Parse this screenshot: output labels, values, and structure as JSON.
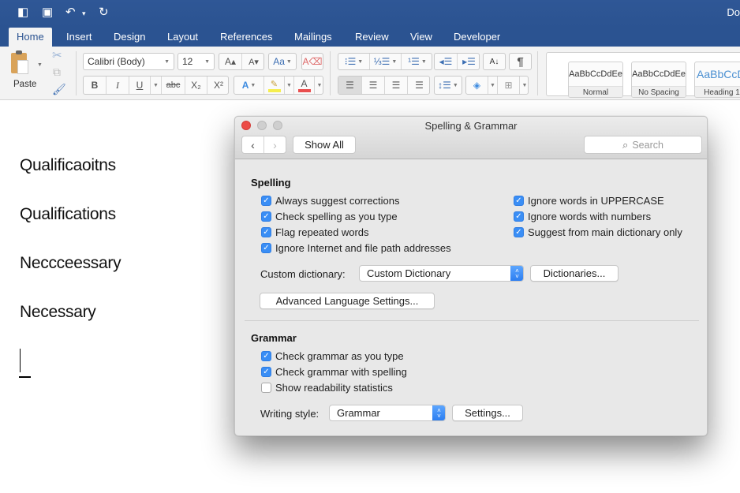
{
  "window": {
    "title_partial": "Do"
  },
  "quick_access": {
    "icons": [
      "sidebar-icon",
      "save-icon",
      "undo-icon",
      "redo-icon"
    ],
    "glyphs": {
      "sidebar": "◧",
      "save": "▣",
      "undo": "↶",
      "undo_caret": "▾",
      "redo": "↻"
    }
  },
  "tabs": [
    {
      "label": "Home",
      "active": true
    },
    {
      "label": "Insert",
      "active": false
    },
    {
      "label": "Design",
      "active": false
    },
    {
      "label": "Layout",
      "active": false
    },
    {
      "label": "References",
      "active": false
    },
    {
      "label": "Mailings",
      "active": false
    },
    {
      "label": "Review",
      "active": false
    },
    {
      "label": "View",
      "active": false
    },
    {
      "label": "Developer",
      "active": false
    }
  ],
  "ribbon": {
    "paste_label": "Paste",
    "font_name": "Calibri (Body)",
    "font_size": "12",
    "format_glyphs": {
      "grow": "A▴",
      "shrink": "A▾",
      "change_case": "Aa",
      "clear": "A⌫",
      "bold": "B",
      "italic": "I",
      "underline": "U",
      "strike": "abc",
      "subscript": "X₂",
      "superscript": "X²",
      "text_effects": "A",
      "highlight": "✎",
      "font_color": "A",
      "bullets": "⁝☰",
      "numbering": "⅓☰",
      "multilevel": "¹☰",
      "decrease_indent": "◂☰",
      "increase_indent": "▸☰",
      "sort": "A↓",
      "pilcrow": "¶",
      "align_left": "☰",
      "align_center": "☰",
      "align_right": "☰",
      "justify": "☰",
      "line_spacing": "↕☰",
      "shading": "◈",
      "borders": "⊞"
    },
    "colors": {
      "highlight": "#f5ee4e",
      "font_color": "#e94e4e",
      "heading_blue": "#4a8fd1"
    },
    "styles": [
      {
        "sample": "AaBbCcDdEe",
        "name": "Normal"
      },
      {
        "sample": "AaBbCcDdEe",
        "name": "No Spacing"
      },
      {
        "sample": "AaBbCcDd",
        "name": "Heading 1"
      }
    ]
  },
  "document": {
    "lines": [
      "Qualificaoitns",
      "Qualifications",
      "Neccceessary",
      "Necessary"
    ]
  },
  "dialog": {
    "title": "Spelling & Grammar",
    "back_glyph": "‹",
    "forward_glyph": "›",
    "show_all_label": "Show All",
    "search_placeholder": "Search",
    "search_glyph": "⌕",
    "spelling": {
      "heading": "Spelling",
      "left_options": [
        {
          "label": "Always suggest corrections",
          "checked": true
        },
        {
          "label": "Check spelling as you type",
          "checked": true
        },
        {
          "label": "Flag repeated words",
          "checked": true
        },
        {
          "label": "Ignore Internet and file path addresses",
          "checked": true
        }
      ],
      "right_options": [
        {
          "label": "Ignore words in UPPERCASE",
          "checked": true
        },
        {
          "label": "Ignore words with numbers",
          "checked": true
        },
        {
          "label": "Suggest from main dictionary only",
          "checked": true
        }
      ],
      "custom_dictionary_label": "Custom dictionary:",
      "custom_dictionary_value": "Custom Dictionary",
      "dictionaries_button": "Dictionaries...",
      "advanced_button": "Advanced Language Settings..."
    },
    "grammar": {
      "heading": "Grammar",
      "options": [
        {
          "label": "Check grammar as you type",
          "checked": true
        },
        {
          "label": "Check grammar with spelling",
          "checked": true
        },
        {
          "label": "Show readability statistics",
          "checked": false
        }
      ],
      "writing_style_label": "Writing style:",
      "writing_style_value": "Grammar",
      "settings_button": "Settings..."
    },
    "check_glyph": "✓",
    "stepper_up": "˄",
    "stepper_down": "˅"
  }
}
